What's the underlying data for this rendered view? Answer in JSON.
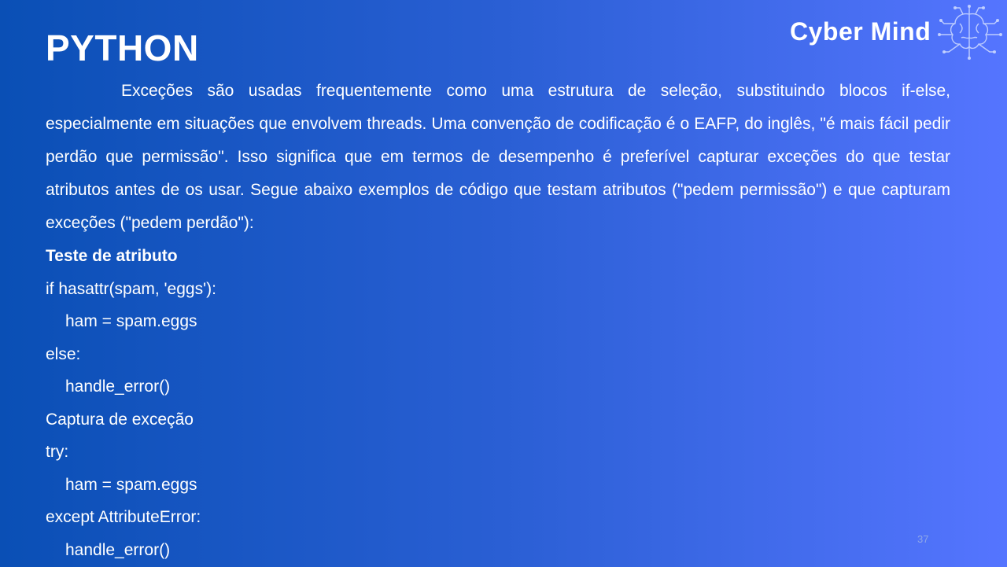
{
  "slide": {
    "title": "PYTHON",
    "logo_text": "Cyber Mind",
    "paragraph": "Exceções são usadas frequentemente como uma estrutura de seleção, substituindo blocos if-else, especialmente em situações que envolvem threads. Uma convenção de codificação é o EAFP, do inglês, \"é mais fácil pedir perdão que permissão\". Isso significa que em termos de desempenho é preferível capturar exceções do que testar atributos antes de os usar. Segue abaixo exemplos de código que testam atributos (\"pedem permissão\") e que capturam exceções (\"pedem perdão\"):",
    "lines": [
      "Teste de atributo",
      "if hasattr(spam, 'eggs'):",
      "ham = spam.eggs",
      "else:",
      "handle_error()",
      "Captura de exceção",
      "try:",
      "ham = spam.eggs",
      "except AttributeError:",
      "handle_error()"
    ],
    "page_number": "37"
  },
  "colors": {
    "background_start": "#0a4fb5",
    "background_end": "#5575ff",
    "text": "#ffffff"
  }
}
